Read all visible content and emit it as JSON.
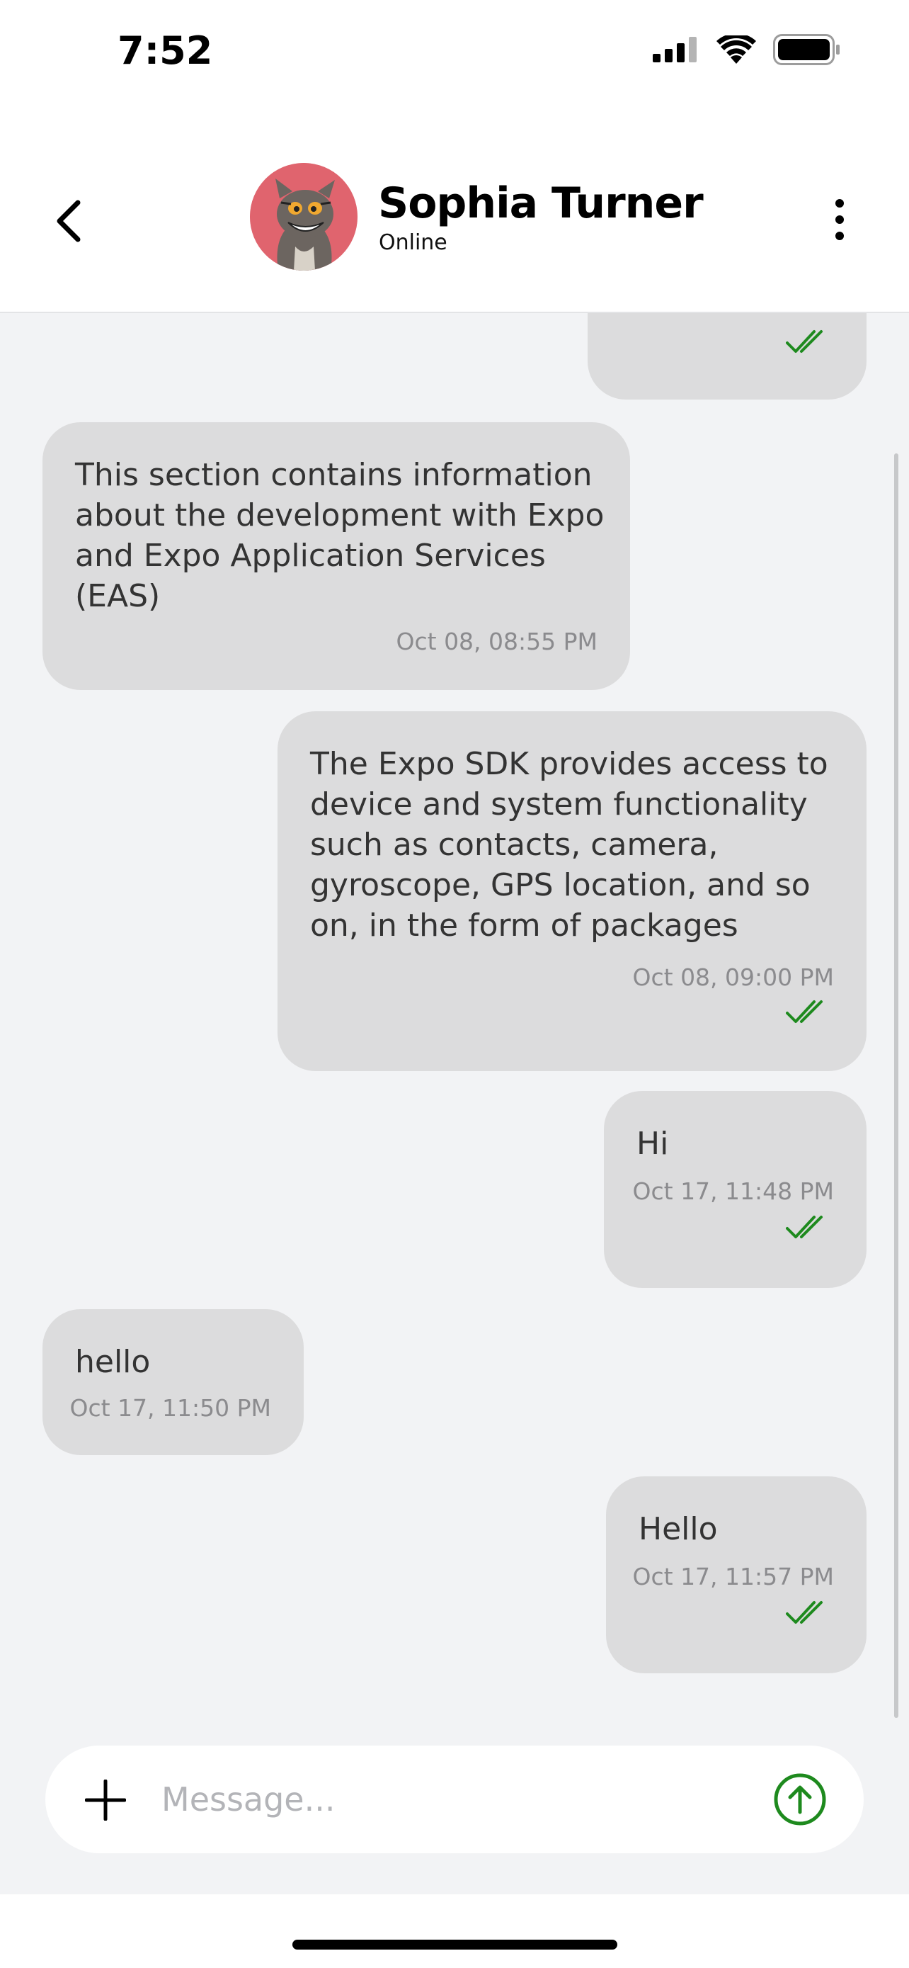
{
  "status_bar": {
    "time": "7:52"
  },
  "header": {
    "contact_name": "Sophia Turner",
    "contact_status": "Online"
  },
  "messages": [
    {
      "side": "right",
      "text": "",
      "time": "",
      "read": true
    },
    {
      "side": "left",
      "text": "This section contains information\nabout the development with Expo\nand Expo Application Services\n(EAS)",
      "time": "Oct 08, 08:55 PM",
      "read": false
    },
    {
      "side": "right",
      "text": "The Expo SDK provides access to\ndevice and system functionality\nsuch as contacts, camera,\ngyroscope, GPS location, and so\non, in the form of packages",
      "time": "Oct 08, 09:00 PM",
      "read": true
    },
    {
      "side": "right",
      "text": "Hi",
      "time": "Oct 17, 11:48 PM",
      "read": true
    },
    {
      "side": "left",
      "text": "hello",
      "time": "Oct 17, 11:50 PM",
      "read": false
    },
    {
      "side": "right",
      "text": "Hello",
      "time": "Oct 17, 11:57 PM",
      "read": true
    }
  ],
  "composer": {
    "placeholder": "Message..."
  },
  "colors": {
    "accent": "#1e8a1e",
    "bubble": "#dcdcdd",
    "chat_background": "#f2f3f5",
    "avatar_background": "#e0646e"
  },
  "icons": {
    "back": "chevron-left-icon",
    "more": "more-vertical-icon",
    "add": "plus-icon",
    "send": "arrow-up-circle-icon",
    "read_receipt": "double-check-icon"
  }
}
